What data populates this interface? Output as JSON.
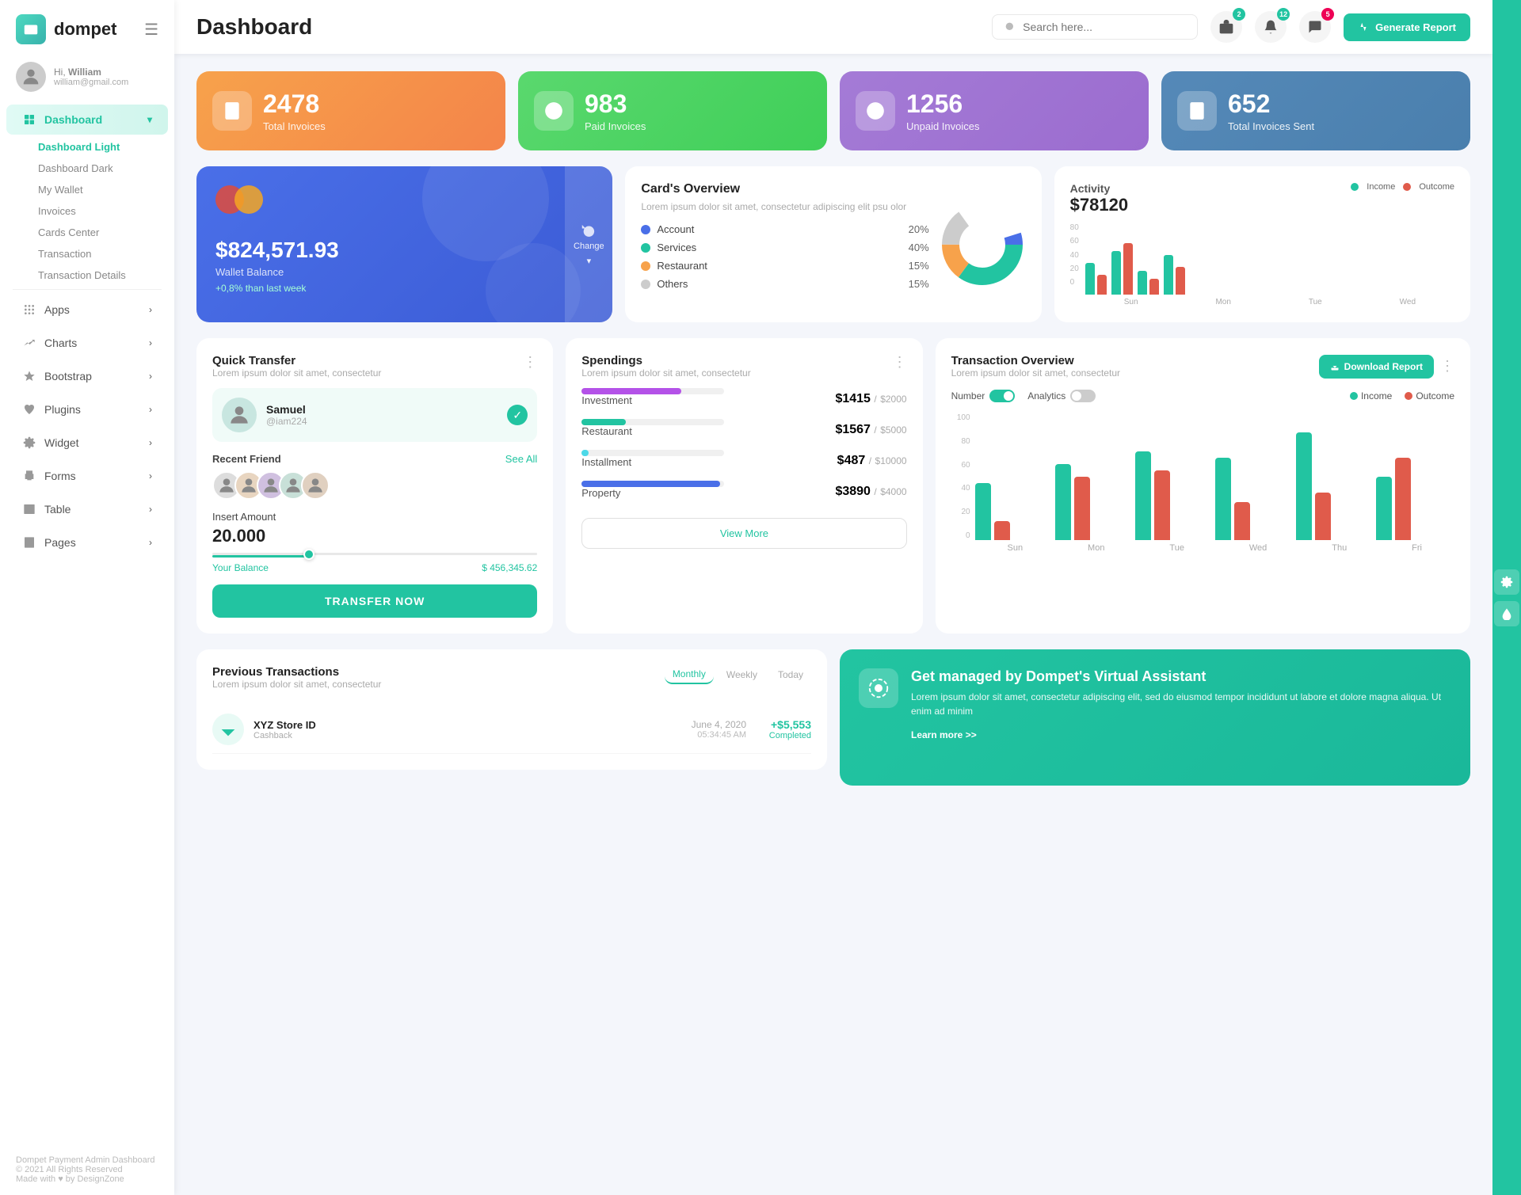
{
  "sidebar": {
    "logo": "dompet",
    "hamburger": "☰",
    "user": {
      "hi": "Hi,",
      "name": "William",
      "email": "william@gmail.com"
    },
    "nav": [
      {
        "id": "dashboard",
        "label": "Dashboard",
        "icon": "grid-icon",
        "active": true,
        "arrow": "▾",
        "sub": [
          {
            "label": "Dashboard Light",
            "active": true
          },
          {
            "label": "Dashboard Dark"
          },
          {
            "label": "My Wallet"
          },
          {
            "label": "Invoices"
          },
          {
            "label": "Cards Center"
          },
          {
            "label": "Transaction"
          },
          {
            "label": "Transaction Details"
          }
        ]
      },
      {
        "id": "apps",
        "label": "Apps",
        "icon": "apps-icon",
        "arrow": "›"
      },
      {
        "id": "charts",
        "label": "Charts",
        "icon": "charts-icon",
        "arrow": "›"
      },
      {
        "id": "bootstrap",
        "label": "Bootstrap",
        "icon": "star-icon",
        "arrow": "›"
      },
      {
        "id": "plugins",
        "label": "Plugins",
        "icon": "heart-icon",
        "arrow": "›"
      },
      {
        "id": "widget",
        "label": "Widget",
        "icon": "gear-icon",
        "arrow": "›"
      },
      {
        "id": "forms",
        "label": "Forms",
        "icon": "printer-icon",
        "arrow": "›"
      },
      {
        "id": "table",
        "label": "Table",
        "icon": "table-icon",
        "arrow": "›"
      },
      {
        "id": "pages",
        "label": "Pages",
        "icon": "pages-icon",
        "arrow": "›"
      }
    ],
    "footer": {
      "brand": "Dompet Payment Admin Dashboard",
      "copy": "© 2021 All Rights Reserved",
      "made": "Made with ♥ by DesignZone"
    }
  },
  "header": {
    "title": "Dashboard",
    "search_placeholder": "Search here...",
    "icons": {
      "bag_badge": "2",
      "bell_badge": "12",
      "chat_badge": "5"
    },
    "generate_btn": "Generate Report"
  },
  "stats": [
    {
      "id": "total",
      "num": "2478",
      "label": "Total Invoices",
      "color": "orange"
    },
    {
      "id": "paid",
      "num": "983",
      "label": "Paid Invoices",
      "color": "green"
    },
    {
      "id": "unpaid",
      "num": "1256",
      "label": "Unpaid Invoices",
      "color": "purple"
    },
    {
      "id": "sent",
      "num": "652",
      "label": "Total Invoices Sent",
      "color": "blue"
    }
  ],
  "wallet": {
    "amount": "$824,571.93",
    "label": "Wallet Balance",
    "change": "+0,8% than last week",
    "change_btn": "Change"
  },
  "cards_overview": {
    "title": "Card's Overview",
    "subtitle": "Lorem ipsum dolor sit amet, consectetur adipiscing elit psu olor",
    "legend": [
      {
        "label": "Account",
        "pct": "20%",
        "color": "#4a6fe8"
      },
      {
        "label": "Services",
        "pct": "40%",
        "color": "#22c4a1"
      },
      {
        "label": "Restaurant",
        "pct": "15%",
        "color": "#f7a24b"
      },
      {
        "label": "Others",
        "pct": "15%",
        "color": "#ccc"
      }
    ]
  },
  "activity": {
    "title": "Activity",
    "amount": "$78120",
    "income_label": "Income",
    "outcome_label": "Outcome",
    "income_color": "#22c4a1",
    "outcome_color": "#e05b4b",
    "bars": [
      {
        "day": "Sun",
        "income": 40,
        "outcome": 25
      },
      {
        "day": "Mon",
        "income": 55,
        "outcome": 65
      },
      {
        "day": "Tue",
        "income": 30,
        "outcome": 20
      },
      {
        "day": "Wed",
        "income": 50,
        "outcome": 35
      }
    ],
    "y_labels": [
      "0",
      "20",
      "40",
      "60",
      "80"
    ]
  },
  "quick_transfer": {
    "title": "Quick Transfer",
    "subtitle": "Lorem ipsum dolor sit amet, consectetur",
    "recipient": {
      "name": "Samuel",
      "id": "@iam224"
    },
    "recent_friends": "Recent Friend",
    "see_all": "See All",
    "insert_label": "Insert Amount",
    "amount": "20.000",
    "balance_label": "Your Balance",
    "balance": "$ 456,345.62",
    "transfer_btn": "TRANSFER NOW"
  },
  "spendings": {
    "title": "Spendings",
    "subtitle": "Lorem ipsum dolor sit amet, consectetur",
    "items": [
      {
        "label": "Investment",
        "amount": "$1415",
        "limit": "$2000",
        "pct": 70,
        "color": "#b452e8"
      },
      {
        "label": "Restaurant",
        "amount": "$1567",
        "limit": "$5000",
        "pct": 31,
        "color": "#22c4a1"
      },
      {
        "label": "Installment",
        "amount": "$487",
        "limit": "$10000",
        "pct": 5,
        "color": "#4dd9e8"
      },
      {
        "label": "Property",
        "amount": "$3890",
        "limit": "$4000",
        "pct": 97,
        "color": "#4a6fe8"
      }
    ],
    "view_more": "View More"
  },
  "transaction_overview": {
    "title": "Transaction Overview",
    "subtitle": "Lorem ipsum dolor sit amet, consectetur",
    "download_btn": "Download Report",
    "toggle1": "Number",
    "toggle2": "Analytics",
    "income_label": "Income",
    "outcome_label": "Outcome",
    "income_color": "#22c4a1",
    "outcome_color": "#e05b4b",
    "y_labels": [
      "0",
      "20",
      "40",
      "60",
      "80",
      "100"
    ],
    "bars": [
      {
        "day": "Sun",
        "income": 45,
        "outcome": 15
      },
      {
        "day": "Mon",
        "income": 60,
        "outcome": 50
      },
      {
        "day": "Tue",
        "income": 70,
        "outcome": 55
      },
      {
        "day": "Wed",
        "income": 65,
        "outcome": 30
      },
      {
        "day": "Thu",
        "income": 85,
        "outcome": 38
      },
      {
        "day": "Fri",
        "income": 50,
        "outcome": 65
      }
    ]
  },
  "previous_transactions": {
    "title": "Previous Transactions",
    "subtitle": "Lorem ipsum dolor sit amet, consectetur",
    "filters": [
      "Monthly",
      "Weekly",
      "Today"
    ],
    "active_filter": "Monthly",
    "rows": [
      {
        "name": "XYZ Store ID",
        "type": "Cashback",
        "date": "June 4, 2020",
        "time": "05:34:45 AM",
        "amount": "+$5,553",
        "status": "Completed"
      }
    ]
  },
  "virtual_assistant": {
    "title": "Get managed by Dompet's Virtual Assistant",
    "text": "Lorem ipsum dolor sit amet, consectetur adipiscing elit, sed do eiusmod tempor incididunt ut labore et dolore magna aliqua. Ut enim ad minim",
    "link": "Learn more >>"
  }
}
